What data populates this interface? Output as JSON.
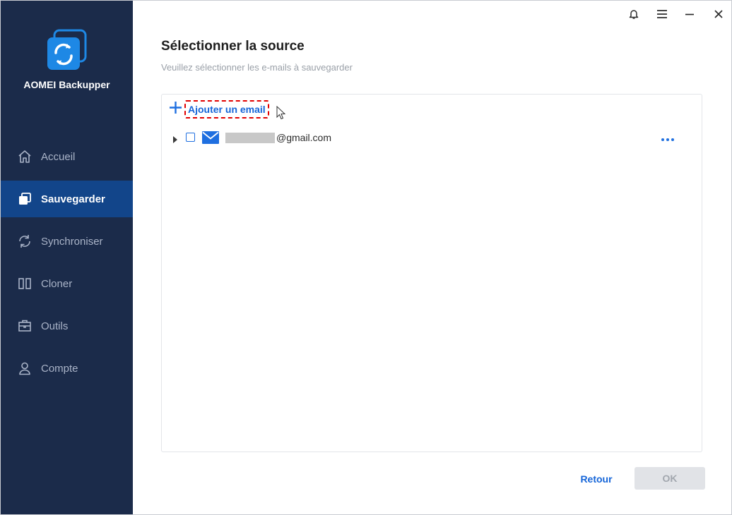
{
  "app": {
    "name": "AOMEI Backupper"
  },
  "sidebar": {
    "items": [
      {
        "label": "Accueil",
        "icon": "home-icon",
        "active": false
      },
      {
        "label": "Sauvegarder",
        "icon": "backup-icon",
        "active": true
      },
      {
        "label": "Synchroniser",
        "icon": "sync-icon",
        "active": false
      },
      {
        "label": "Cloner",
        "icon": "clone-icon",
        "active": false
      },
      {
        "label": "Outils",
        "icon": "tools-icon",
        "active": false
      },
      {
        "label": "Compte",
        "icon": "user-icon",
        "active": false
      }
    ]
  },
  "titlebar": {
    "buttons": [
      "bell-icon",
      "menu-icon",
      "minimize-icon",
      "close-icon"
    ]
  },
  "main": {
    "title": "Sélectionner la source",
    "subtitle": "Veuillez sélectionner les e-mails à sauvegarder",
    "add_email_label": "Ajouter un email",
    "accounts": [
      {
        "email_suffix": "@gmail.com",
        "checked": false,
        "expanded": false
      }
    ]
  },
  "footer": {
    "back_label": "Retour",
    "ok_label": "OK",
    "ok_enabled": false
  },
  "colors": {
    "sidebar_bg": "#1b2b4a",
    "active_item": "#12458a",
    "accent": "#1565d8"
  }
}
